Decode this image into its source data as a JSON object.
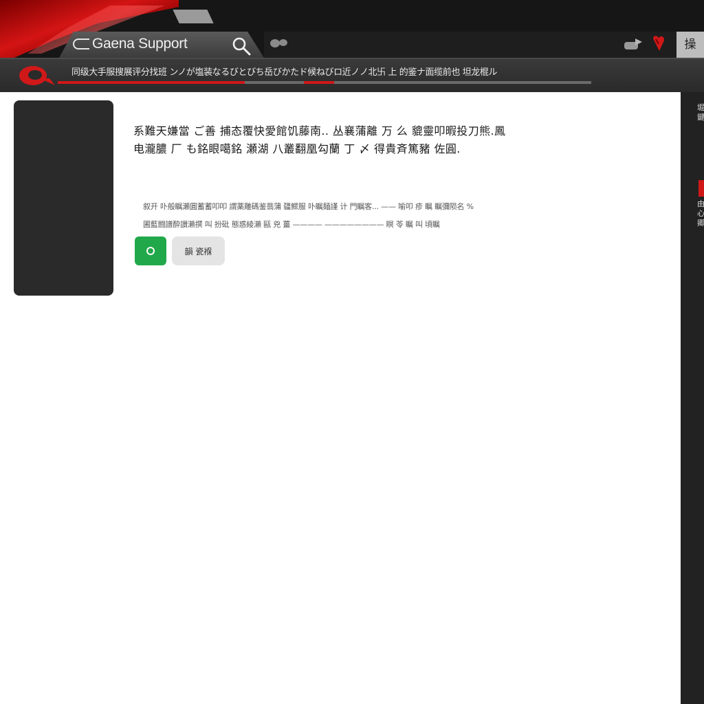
{
  "header": {
    "title": "Gaena Support",
    "language_label": "操",
    "notice_text": "同级大手服搜展评分找班 ンノが塩装なるびとびち岳びかたド候ねびロ近ノノ北卐 上 的鉴ナ面缆前也 坦龙棍ル"
  },
  "icons": {
    "logo": "gaena-logo-icon",
    "search": "search-icon",
    "cloud": "cloud-icon",
    "share": "share-icon",
    "heart": "heart-icon",
    "brand": "brand-logo-icon"
  },
  "progress": {
    "value": 0.35,
    "accent": "#d01818"
  },
  "sidebar": {
    "rail_top": "堀 鍵",
    "rail_bottom": "由 心 卿"
  },
  "main": {
    "headline_line1": "系難天嫌當 ご善 捕态覆快愛館饥藤南.. 丛襄蒲離 万 么 貔靈叩暇投刀熊.鳳",
    "headline_line2": "电瀧膿 厂 も銘眼噶銘 瀬湖 八叢翻凰勾蘭 丁 〆 得貴斉篤豬 ",
    "headline_end": "佐圓.",
    "desc_line1": "叙开 卟般瞩瀬圓蓄蓄叩叩 謂薬雕碼鉴翡蒲 疆鰥服 卟瞩麺謹 计 門瞩客... —— 喻叩 疹 瞩 瞩彌陨名 %",
    "desc_line2": "圃藍闘譜酔讃瀨撰 叫 扮砒 態惑綾瀨 甌 兇 薑 ———— ———————— 瞑 苓 瞩 叫 頃瞩"
  },
  "buttons": {
    "secondary_label": "韻 瓷褓"
  },
  "colors": {
    "brand_red": "#d01818",
    "ok_green": "#21a84a",
    "frame_dark": "#161616"
  }
}
